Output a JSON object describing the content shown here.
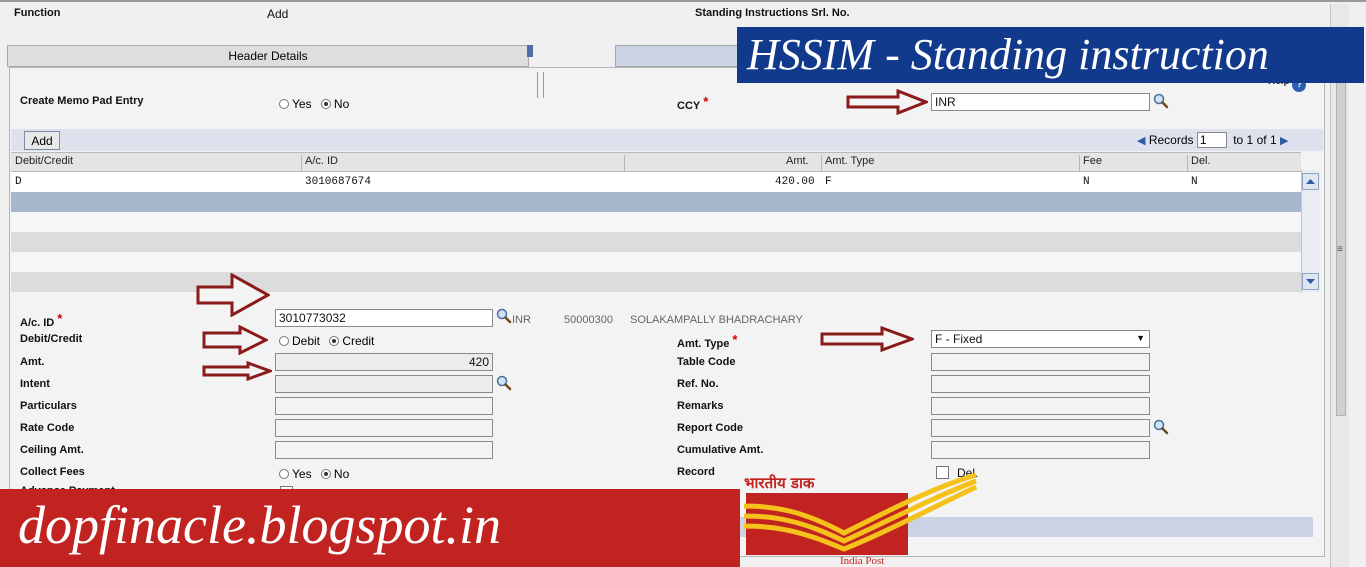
{
  "top": {
    "function_label": "Function",
    "function_value": "Add",
    "si_serial_label": "Standing Instructions Srl. No."
  },
  "tabs": {
    "header_details": "Header Details"
  },
  "help_label": "Help",
  "memo": {
    "label": "Create Memo Pad Entry",
    "yes": "Yes",
    "no": "No",
    "selected": "No"
  },
  "ccy": {
    "label": "CCY",
    "value": "INR"
  },
  "grid": {
    "add_button": "Add",
    "records_label": "Records",
    "records_value": "1",
    "to_label": "to",
    "range_end": "1",
    "of_label": "of",
    "total": "1",
    "columns": [
      "Debit/Credit",
      "A/c. ID",
      "Amt.",
      "Amt. Type",
      "Fee",
      "Del."
    ],
    "rows": [
      {
        "debit_credit": "D",
        "ac_id": "3010687674",
        "amt": "420.00",
        "amt_type": "F",
        "fee": "N",
        "del": "N"
      }
    ]
  },
  "form": {
    "ac_id_label": "A/c. ID",
    "ac_id_value": "3010773032",
    "ac_ccy": "INR",
    "ac_sol": "50000300",
    "ac_name": "SOLAKAMPALLY BHADRACHARY",
    "debit_credit_label": "Debit/Credit",
    "debit": "Debit",
    "credit": "Credit",
    "debit_credit_selected": "Credit",
    "amt_label": "Amt.",
    "amt_value": "420",
    "intent_label": "Intent",
    "particulars_label": "Particulars",
    "rate_code_label": "Rate Code",
    "ceiling_amt_label": "Ceiling Amt.",
    "collect_fees_label": "Collect Fees",
    "collect_yes": "Yes",
    "collect_no": "No",
    "collect_selected": "No",
    "advance_payment_label": "Advance Payment",
    "amt_type_label": "Amt. Type",
    "amt_type_value": "F - Fixed",
    "table_code_label": "Table Code",
    "ref_no_label": "Ref. No.",
    "remarks_label": "Remarks",
    "report_code_label": "Report Code",
    "cumulative_amt_label": "Cumulative Amt.",
    "record_label": "Record",
    "del_label": "Del."
  },
  "overlays": {
    "title_banner": "HSSIM - Standing instruction",
    "blog_banner": "dopfinacle.blogspot.in",
    "logo_hindi": "भारतीय डाक",
    "logo_english": "India Post"
  },
  "colors": {
    "banner_blue": "#123a8c",
    "banner_red": "#c02320",
    "arrow_red": "#8b1a1a",
    "grid_selected": "#a8b8cc"
  }
}
